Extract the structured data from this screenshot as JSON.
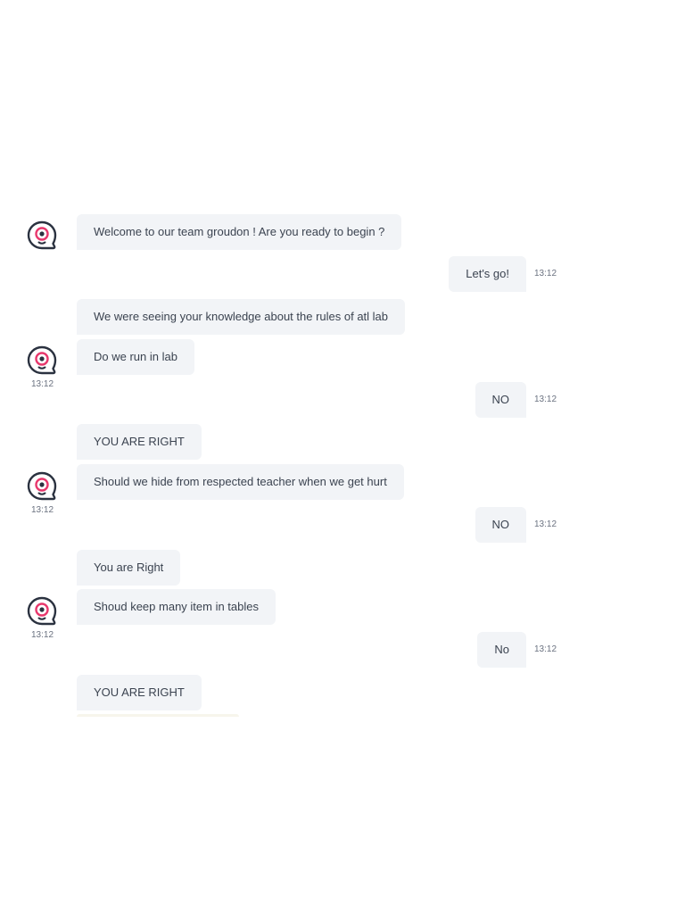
{
  "conversation": {
    "messages": [
      {
        "sender": "bot",
        "text": "Welcome to our team groudon ! Are you ready to begin ?"
      },
      {
        "sender": "user",
        "text": "Let's go!",
        "time": "13:12"
      },
      {
        "sender": "bot",
        "text": "We were seeing your knowledge about the rules of atl lab"
      },
      {
        "sender": "bot",
        "text": "Do we run in lab",
        "time": "13:12"
      },
      {
        "sender": "user",
        "text": "NO",
        "time": "13:12"
      },
      {
        "sender": "bot",
        "text": "YOU ARE RIGHT"
      },
      {
        "sender": "bot",
        "text": "Should we hide from respected teacher when we get hurt",
        "time": "13:12"
      },
      {
        "sender": "user",
        "text": "NO",
        "time": "13:12"
      },
      {
        "sender": "bot",
        "text": "You are Right"
      },
      {
        "sender": "bot",
        "text": "Shoud keep many item in tables",
        "time": "13:12"
      },
      {
        "sender": "user",
        "text": "No",
        "time": "13:12"
      },
      {
        "sender": "bot",
        "text": "YOU ARE RIGHT"
      }
    ]
  },
  "theme": {
    "bubble_bg": "#f2f4f7",
    "text": "#3b4350",
    "timestamp": "#6b7280",
    "avatar_stroke": "#2b3240",
    "avatar_accent": "#e8386d"
  },
  "icons": {
    "bot_avatar": "chat-bot-avatar-icon"
  }
}
